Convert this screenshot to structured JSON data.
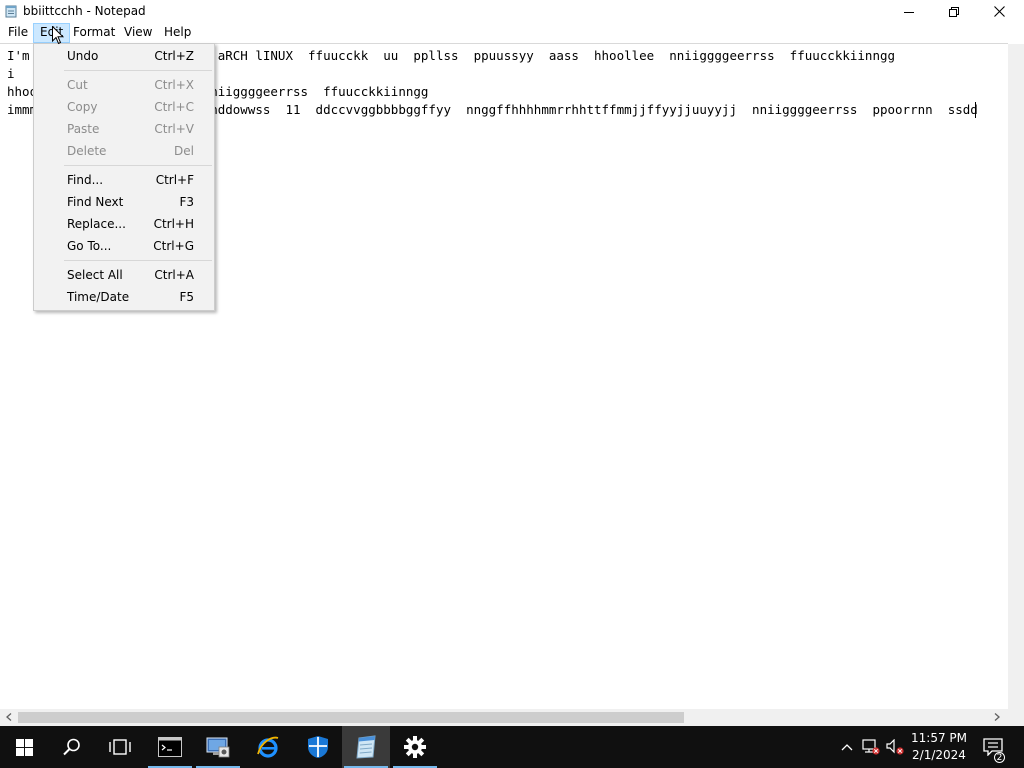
{
  "window": {
    "title": "bbiittcchh - Notepad",
    "icon": "notepad-icon"
  },
  "menubar": {
    "items": [
      {
        "label": "File"
      },
      {
        "label": "Edit"
      },
      {
        "label": "Format"
      },
      {
        "label": "View"
      },
      {
        "label": "Help"
      }
    ],
    "active": "Edit"
  },
  "editor": {
    "lines": [
      "I'm writing this message ON aRCH lINUX  ffuucckk  uu  ppllss  ppuussyy  aass  hhoollee  nniiggggeerrss  ffuucckkiinngg",
      "i",
      "hhoollee  nniiggggeerrss  nniiggggeerrss  ffuucckkiinngg",
      "immmmmmm    sshhiitt  wwiinnddowwss  11  ddccvvggbbbbggffyy  nnggffhhhhmmrrhhttffmmjjffyyjjuuyyjj  nniiggggeerrss  ppoorrnn  ssdd"
    ]
  },
  "edit_menu": {
    "groups": [
      [
        {
          "label": "Undo",
          "shortcut": "Ctrl+Z",
          "enabled": true
        }
      ],
      [
        {
          "label": "Cut",
          "shortcut": "Ctrl+X",
          "enabled": false
        },
        {
          "label": "Copy",
          "shortcut": "Ctrl+C",
          "enabled": false
        },
        {
          "label": "Paste",
          "shortcut": "Ctrl+V",
          "enabled": false
        },
        {
          "label": "Delete",
          "shortcut": "Del",
          "enabled": false
        }
      ],
      [
        {
          "label": "Find...",
          "shortcut": "Ctrl+F",
          "enabled": true
        },
        {
          "label": "Find Next",
          "shortcut": "F3",
          "enabled": true
        },
        {
          "label": "Replace...",
          "shortcut": "Ctrl+H",
          "enabled": true
        },
        {
          "label": "Go To...",
          "shortcut": "Ctrl+G",
          "enabled": true
        }
      ],
      [
        {
          "label": "Select All",
          "shortcut": "Ctrl+A",
          "enabled": true
        },
        {
          "label": "Time/Date",
          "shortcut": "F5",
          "enabled": true
        }
      ]
    ]
  },
  "taskbar": {
    "pinned": [
      {
        "name": "start-button",
        "icon": "windows-logo-icon"
      },
      {
        "name": "search-button",
        "icon": "search-icon"
      },
      {
        "name": "task-view-button",
        "icon": "task-view-icon"
      },
      {
        "name": "cmd-button",
        "icon": "command-prompt-icon"
      },
      {
        "name": "server-manager-button",
        "icon": "server-manager-icon"
      },
      {
        "name": "ie-button",
        "icon": "internet-explorer-icon"
      },
      {
        "name": "defender-button",
        "icon": "shield-icon"
      },
      {
        "name": "notepad-button",
        "icon": "notepad-icon"
      },
      {
        "name": "settings-button",
        "icon": "gear-icon"
      }
    ],
    "clock": {
      "time": "11:57 PM",
      "date": "2/1/2024"
    },
    "notification_count": "2"
  },
  "colors": {
    "menu_highlight": "#cce8ff",
    "taskbar_bg": "#101010",
    "running_indicator": "#76b9ed",
    "disabled_text": "#8c8c8c"
  }
}
